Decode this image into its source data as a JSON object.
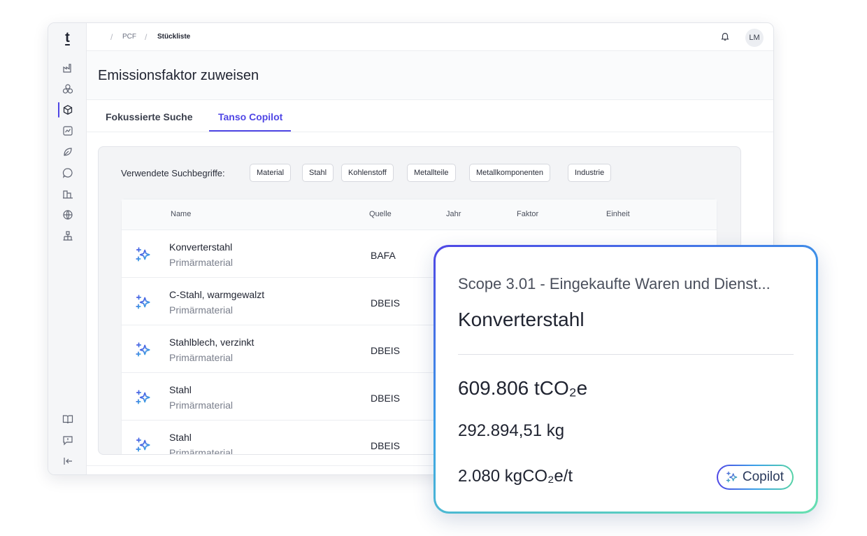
{
  "app": {
    "logo": "t",
    "breadcrumb": [
      "PCF",
      "Stückliste"
    ],
    "avatar": "LM",
    "page_title": "Emissionsfaktor zuweisen",
    "tabs": [
      {
        "label": "Fokussierte Suche",
        "active": false
      },
      {
        "label": "Tanso Copilot",
        "active": true
      }
    ],
    "accent_color": "#4f46e5"
  },
  "sidebar": {
    "icons": [
      "factory-icon",
      "shapes-icon",
      "box-icon",
      "chart-icon",
      "leaf-icon",
      "chat-icon",
      "buildings-icon",
      "globe-icon",
      "organization-icon"
    ],
    "bottom_icons": [
      "book-icon",
      "feedback-icon",
      "collapse-icon"
    ],
    "active_index": 2
  },
  "search": {
    "label": "Verwendete Suchbegriffe:",
    "terms": [
      "Material",
      "Stahl",
      "Kohlenstoff",
      "Metallteile",
      "Metallkomponenten",
      "Industrie"
    ]
  },
  "table": {
    "columns": [
      "Name",
      "Quelle",
      "Jahr",
      "Faktor",
      "Einheit"
    ],
    "rows": [
      {
        "name": "Konverterstahl",
        "category": "Primärmaterial",
        "source": "BAFA"
      },
      {
        "name": "C-Stahl, warmgewalzt",
        "category": "Primärmaterial",
        "source": "DBEIS"
      },
      {
        "name": "Stahlblech, verzinkt",
        "category": "Primärmaterial",
        "source": "DBEIS"
      },
      {
        "name": "Stahl",
        "category": "Primärmaterial",
        "source": "DBEIS"
      },
      {
        "name": "Stahl",
        "category": "Primärmaterial",
        "source": "DBEIS"
      }
    ]
  },
  "card": {
    "scope": "Scope 3.01 - Eingekaufte Waren und Dienst...",
    "name": "Konverterstahl",
    "emission": "609.806 tCO₂e",
    "mass": "292.894,51 kg",
    "factor": "2.080 kgCO₂e/t",
    "badge": "Copilot"
  }
}
